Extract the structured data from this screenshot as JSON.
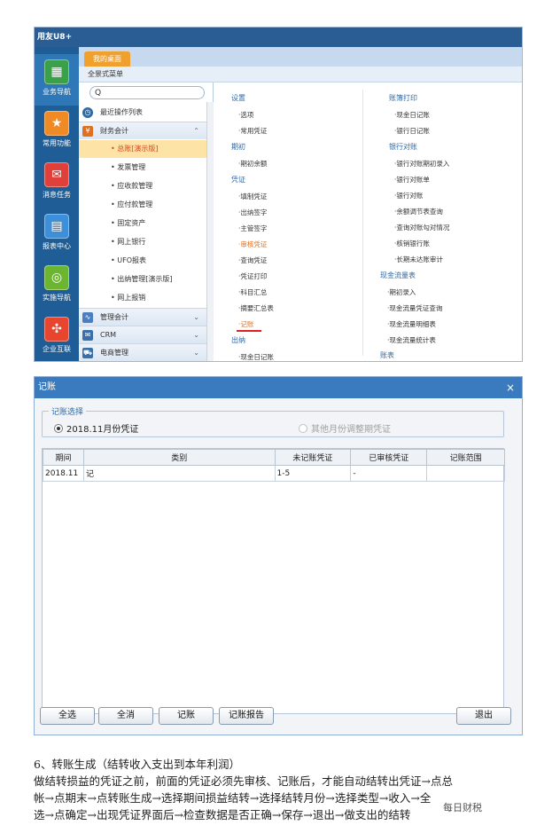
{
  "u8": {
    "title": "用友U8+",
    "tab": "我的桌面",
    "subbar": "全景式菜单",
    "leftnav": [
      {
        "label": "业务导航",
        "icon": "sitemap-icon"
      },
      {
        "label": "常用功能",
        "icon": "star-icon"
      },
      {
        "label": "消息任务",
        "icon": "mail-icon"
      },
      {
        "label": "报表中心",
        "icon": "chart-icon"
      },
      {
        "label": "实施导航",
        "icon": "compass-icon"
      },
      {
        "label": "企业互联",
        "icon": "network-icon"
      }
    ],
    "search_glyph": "Q",
    "tree": {
      "recent": "最近操作列表",
      "finance": "财务会计",
      "items": [
        "• 总账[演示版]",
        "• 发票管理",
        "• 应收款管理",
        "• 应付款管理",
        "• 固定资产",
        "• 网上银行",
        "• UFO报表",
        "• 出纳管理[演示版]",
        "• 网上报销"
      ],
      "mgmt": "管理会计",
      "crm": "CRM",
      "ecom": "电商管理"
    },
    "menu_col1": {
      "settings_head": "设置",
      "settings": [
        "·选项",
        "·常用凭证"
      ],
      "period_head": "期初",
      "period": [
        "·期初余额"
      ],
      "voucher_head": "凭证",
      "voucher": [
        "·填制凭证",
        "·出纳签字",
        "·主管签字",
        "·审核凭证",
        "·查询凭证",
        "·凭证打印",
        "·科目汇总",
        "·摘要汇总表",
        "·记账"
      ],
      "cashier_head": "出纳",
      "cashier": [
        "·现金日记账"
      ]
    },
    "menu_col2": {
      "book_head": "账簿打印",
      "book": [
        "·现金日记账",
        "·银行日记账"
      ],
      "bank_head": "银行对账",
      "bank": [
        "·银行对账期初录入",
        "·银行对账单",
        "·银行对账",
        "·余额调节表查询",
        "·查询对账勾对情况",
        "·核销银行账",
        "·长期未达账审计"
      ],
      "cashflow_head": "现金流量表",
      "cashflow": [
        "·期初录入",
        "·现金流量凭证查询",
        "·现金流量明细表",
        "·现金流量统计表"
      ],
      "ledger_head": "账表"
    }
  },
  "dialog": {
    "title": "记账",
    "close": "×",
    "group_label": "记账选择",
    "radio_current": "2018.11月份凭证",
    "radio_other": "其他月份调整期凭证",
    "columns": [
      "期间",
      "类别",
      "未记账凭证",
      "已审核凭证",
      "记账范围"
    ],
    "rows": [
      [
        "2018.11",
        "记",
        "1-5",
        "-",
        ""
      ]
    ],
    "buttons": {
      "select_all": "全选",
      "clear_all": "全消",
      "post": "记账",
      "report": "记账报告",
      "exit": "退出"
    }
  },
  "article": {
    "heading": "6、转账生成（结转收入支出到本年利润）",
    "line1": "做结转损益的凭证之前，前面的凭证必须先审核、记账后，才能自动结转出凭证→点总",
    "line2": "帐→点期末→点转账生成→选择期间损益结转→选择结转月份→选择类型→收入→全",
    "line3": "选→点确定→出现凭证界面后→检查数据是否正确→保存→退出→做支出的结转",
    "watermark": "每日财税"
  }
}
